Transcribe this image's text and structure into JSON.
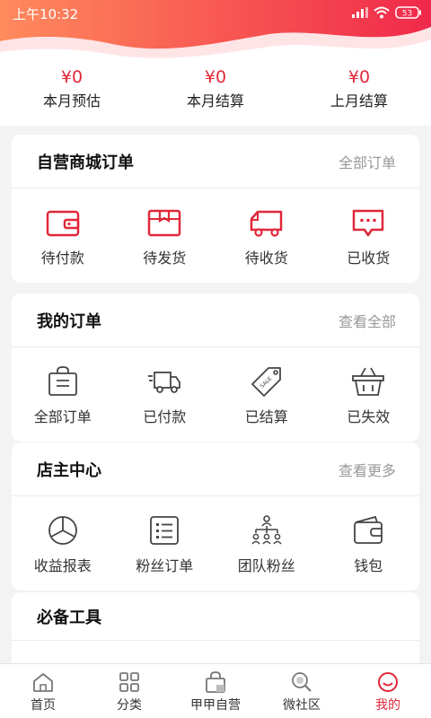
{
  "status": {
    "time": "上午10:32",
    "battery": "53"
  },
  "earnings": [
    {
      "value": "¥0",
      "label": "本月预估"
    },
    {
      "value": "¥0",
      "label": "本月结算"
    },
    {
      "value": "¥0",
      "label": "上月结算"
    }
  ],
  "self_orders": {
    "title": "自营商城订单",
    "link": "全部订单",
    "items": [
      {
        "label": "待付款",
        "icon": "wallet-icon"
      },
      {
        "label": "待发货",
        "icon": "package-icon"
      },
      {
        "label": "待收货",
        "icon": "truck-icon"
      },
      {
        "label": "已收货",
        "icon": "chat-bubble-icon"
      }
    ]
  },
  "my_orders": {
    "title": "我的订单",
    "link": "查看全部",
    "items": [
      {
        "label": "全部订单",
        "icon": "shopping-bag-icon"
      },
      {
        "label": "已付款",
        "icon": "delivery-truck-icon"
      },
      {
        "label": "已结算",
        "icon": "sale-tag-icon",
        "tag_text": "SALE"
      },
      {
        "label": "已失效",
        "icon": "basket-icon"
      }
    ]
  },
  "shop_owner": {
    "title": "店主中心",
    "link": "查看更多",
    "items": [
      {
        "label": "收益报表",
        "icon": "pie-chart-icon"
      },
      {
        "label": "粉丝订单",
        "icon": "list-icon"
      },
      {
        "label": "团队粉丝",
        "icon": "team-tree-icon"
      },
      {
        "label": "钱包",
        "icon": "wallet-outline-icon"
      }
    ]
  },
  "tools": {
    "title": "必备工具"
  },
  "tabbar": [
    {
      "label": "首页",
      "icon": "home-icon"
    },
    {
      "label": "分类",
      "icon": "grid-icon"
    },
    {
      "label": "甲甲自营",
      "icon": "shopping-bag-icon"
    },
    {
      "label": "微社区",
      "icon": "community-search-icon"
    },
    {
      "label": "我的",
      "icon": "profile-icon",
      "active": true
    }
  ],
  "colors": {
    "accent": "#e0283a",
    "header_gradient_start": "#ff8a5c",
    "header_gradient_end": "#f0294a"
  }
}
